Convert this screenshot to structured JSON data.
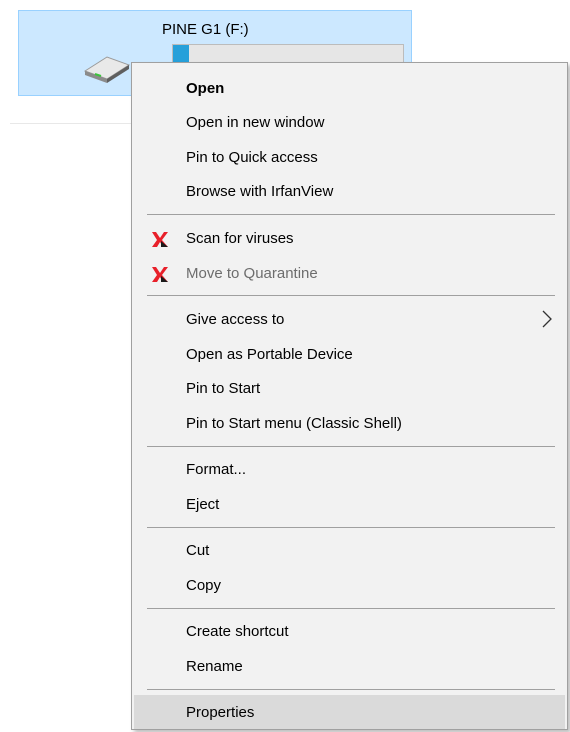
{
  "drive": {
    "name": "PINE G1 (F:)",
    "usage_fraction": 0.07,
    "colors": {
      "tile_bg": "#cce8ff",
      "bar_fill": "#26a0da"
    }
  },
  "menu": {
    "groups": [
      [
        {
          "label": "Open",
          "bold": true
        },
        {
          "label": "Open in new window"
        },
        {
          "label": "Pin to Quick access"
        },
        {
          "label": "Browse with IrfanView"
        }
      ],
      [
        {
          "label": "Scan for viruses",
          "icon": "kaspersky-icon"
        },
        {
          "label": "Move to Quarantine",
          "icon": "kaspersky-icon",
          "disabled": true
        }
      ],
      [
        {
          "label": "Give access to",
          "submenu": true
        },
        {
          "label": "Open as Portable Device"
        },
        {
          "label": "Pin to Start"
        },
        {
          "label": "Pin to Start menu (Classic Shell)"
        }
      ],
      [
        {
          "label": "Format..."
        },
        {
          "label": "Eject"
        }
      ],
      [
        {
          "label": "Cut"
        },
        {
          "label": "Copy"
        }
      ],
      [
        {
          "label": "Create shortcut"
        },
        {
          "label": "Rename"
        }
      ],
      [
        {
          "label": "Properties",
          "highlighted": true
        }
      ]
    ],
    "colors": {
      "background": "#f2f2f2",
      "hover": "#dadada",
      "separator": "#a0a0a0",
      "disabled_text": "#6d6d6d"
    }
  }
}
